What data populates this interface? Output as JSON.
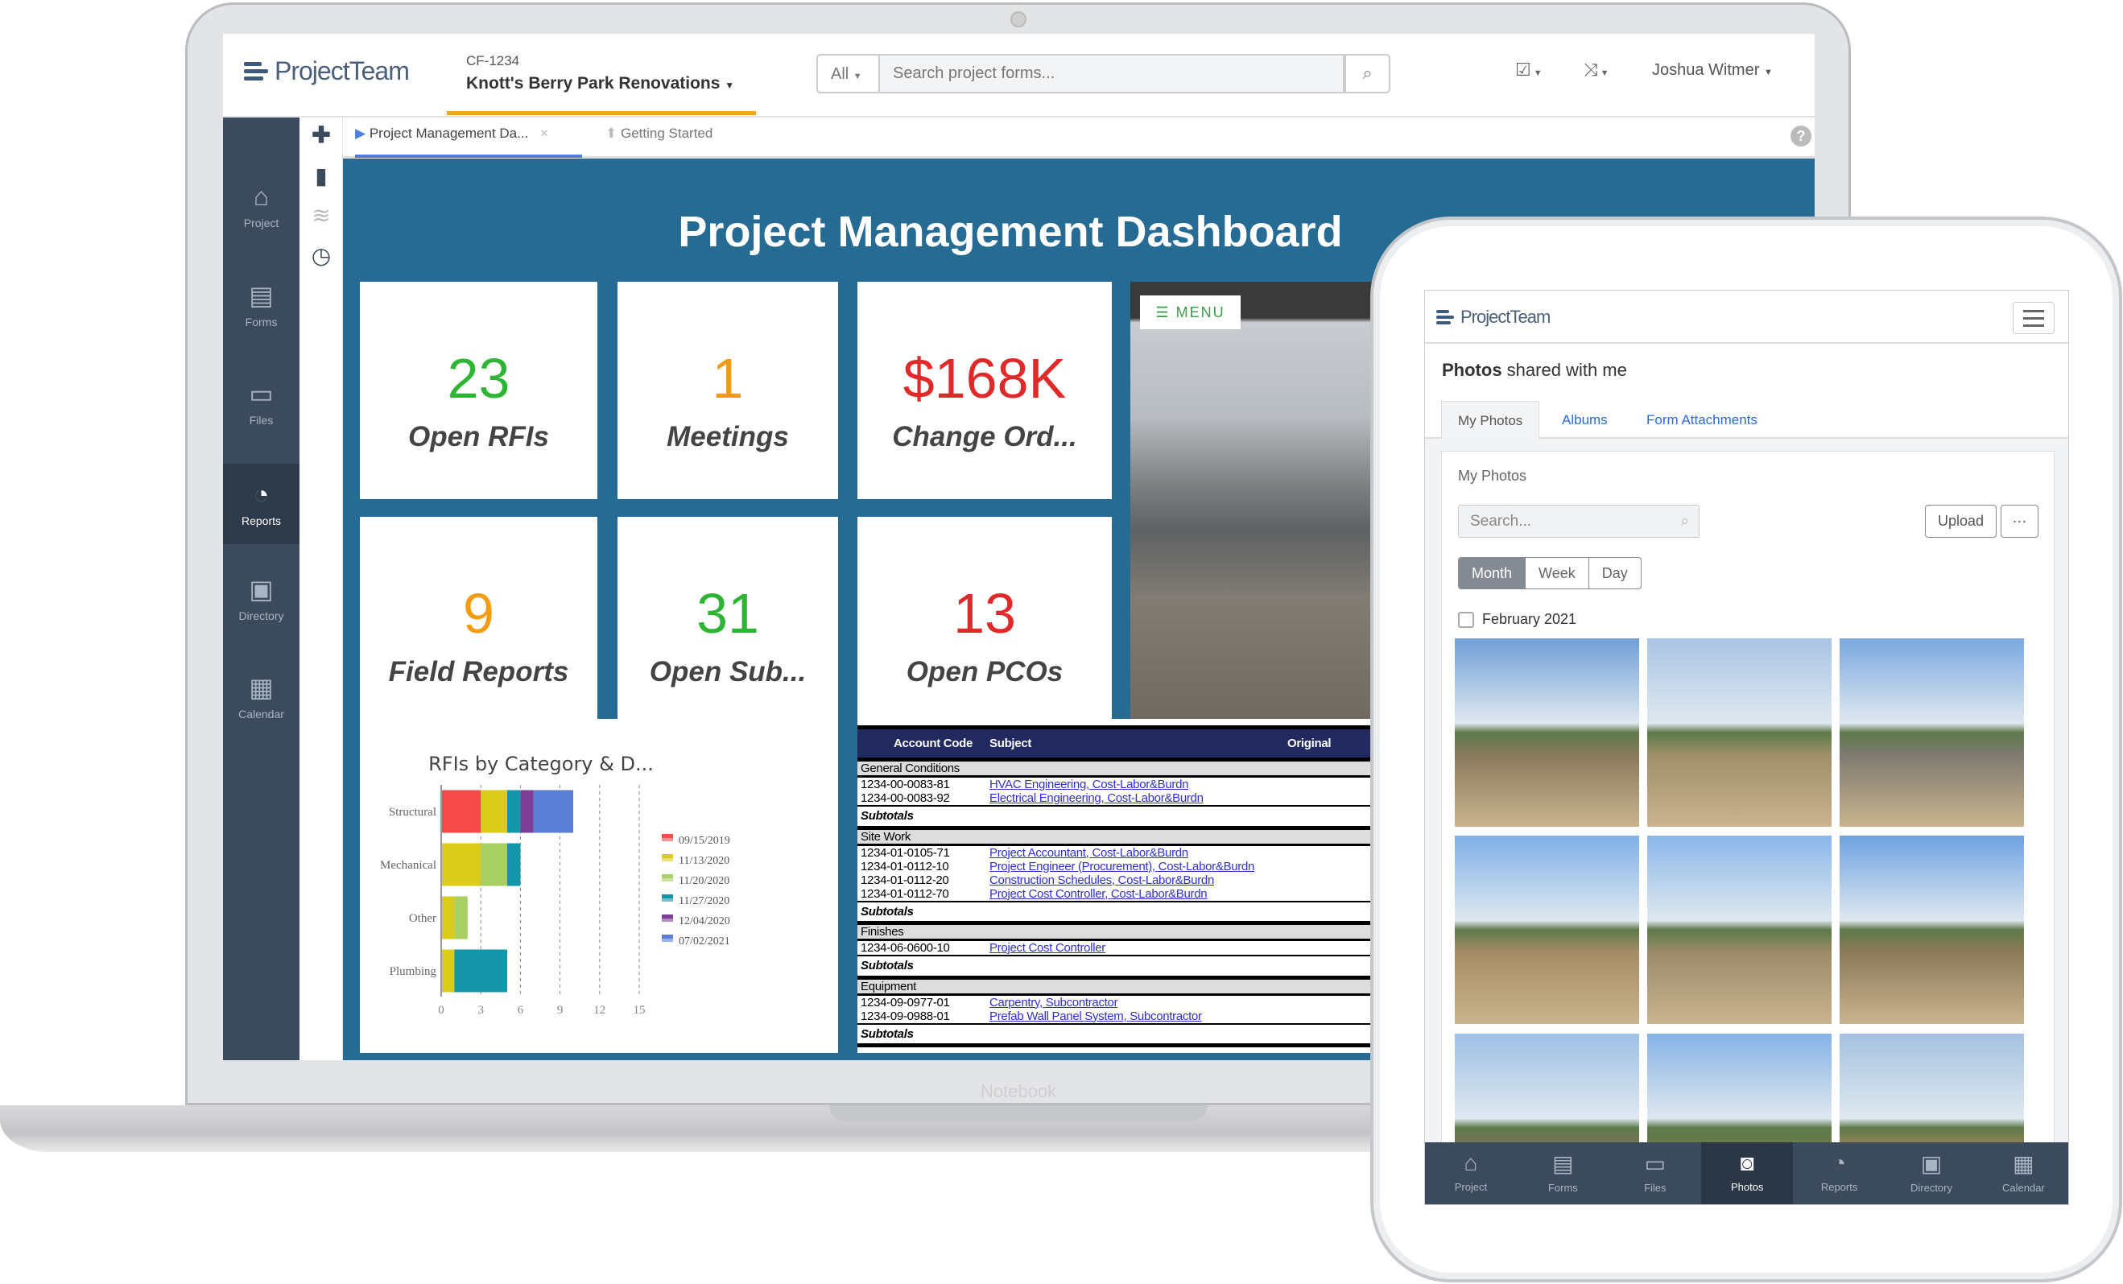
{
  "laptop": {
    "brand_label": "Notebook",
    "header": {
      "logo": "ProjectTeam",
      "project_code": "CF-1234",
      "project_name": "Knott's Berry Park Renovations",
      "search_scope": "All",
      "search_placeholder": "Search project forms...",
      "user_name": "Joshua Witmer"
    },
    "sidebar": [
      {
        "label": "Project",
        "icon": "home-icon",
        "glyph": "⌂"
      },
      {
        "label": "Forms",
        "icon": "document-icon",
        "glyph": "▤"
      },
      {
        "label": "Files",
        "icon": "folder-icon",
        "glyph": "▭"
      },
      {
        "label": "Reports",
        "icon": "dashboard-icon",
        "glyph": "◔",
        "active": true
      },
      {
        "label": "Directory",
        "icon": "contact-book-icon",
        "glyph": "▣"
      },
      {
        "label": "Calendar",
        "icon": "calendar-icon",
        "glyph": "▦"
      }
    ],
    "tabs": [
      {
        "label": "Project Management Da...",
        "active": true
      },
      {
        "label": "Getting Started"
      }
    ],
    "dashboard": {
      "title": "Project Management Dashboard",
      "tiles": [
        {
          "value": "23",
          "label": "Open RFIs",
          "color": "#2db533"
        },
        {
          "value": "1",
          "label": "Meetings",
          "color": "#f39c12"
        },
        {
          "value": "$168K",
          "label": "Change Ord...",
          "color": "#e02a2a"
        },
        {
          "value": "9",
          "label": "Field Reports",
          "color": "#f39c12"
        },
        {
          "value": "31",
          "label": "Open Sub...",
          "color": "#2db533"
        },
        {
          "value": "13",
          "label": "Open PCOs",
          "color": "#e02a2a"
        }
      ],
      "photo_menu_label": "MENU"
    },
    "table": {
      "columns": [
        "Account Code",
        "Subject",
        "Original"
      ],
      "groups": [
        {
          "name": "General Conditions",
          "rows": [
            [
              "1234-00-0083-81",
              "HVAC Engineering, Cost-Labor&Burdn"
            ],
            [
              "1234-00-0083-92",
              "Electrical Engineering, Cost-Labor&Burdn"
            ]
          ]
        },
        {
          "name": "Site Work",
          "rows": [
            [
              "1234-01-0105-71",
              "Project Accountant, Cost-Labor&Burdn"
            ],
            [
              "1234-01-0112-10",
              "Project Engineer (Procurement), Cost-Labor&Burdn"
            ],
            [
              "1234-01-0112-20",
              "Construction Schedules, Cost-Labor&Burdn"
            ],
            [
              "1234-01-0112-70",
              "Project Cost Controller, Cost-Labor&Burdn"
            ]
          ]
        },
        {
          "name": "Finishes",
          "rows": [
            [
              "1234-06-0600-10",
              "Project Cost Controller"
            ]
          ]
        },
        {
          "name": "Equipment",
          "rows": [
            [
              "1234-09-0977-01",
              "Carpentry, Subcontractor"
            ],
            [
              "1234-09-0988-01",
              "Prefab Wall Panel System, Subcontractor"
            ]
          ]
        }
      ],
      "subtotal_label": "Subtotals"
    }
  },
  "chart_data": {
    "type": "bar",
    "orientation": "horizontal",
    "stacked": true,
    "title": "RFIs by Category & D...",
    "categories": [
      "Structural",
      "Mechanical",
      "Other",
      "Plumbing"
    ],
    "series": [
      {
        "name": "09/15/2019",
        "color": "#f64b4b",
        "values": [
          3,
          0,
          0,
          0
        ]
      },
      {
        "name": "11/13/2020",
        "color": "#dbcc1c",
        "values": [
          2,
          3,
          1,
          1
        ]
      },
      {
        "name": "11/20/2020",
        "color": "#a8d062",
        "values": [
          0,
          2,
          1,
          0
        ]
      },
      {
        "name": "11/27/2020",
        "color": "#1496a8",
        "values": [
          1,
          1,
          0,
          4
        ]
      },
      {
        "name": "12/04/2020",
        "color": "#7b3f98",
        "values": [
          1,
          0,
          0,
          0
        ]
      },
      {
        "name": "07/02/2021",
        "color": "#5b7fd6",
        "values": [
          3,
          0,
          0,
          0
        ]
      }
    ],
    "xlim": [
      0,
      15
    ],
    "xticks": [
      0,
      3,
      6,
      9,
      12,
      15
    ],
    "grid": "vertical dashed",
    "legend": "right"
  },
  "tablet": {
    "logo": "ProjectTeam",
    "title_bold": "Photos",
    "title_rest": " shared with me",
    "tabs": [
      {
        "label": "My Photos",
        "active": true
      },
      {
        "label": "Albums"
      },
      {
        "label": "Form Attachments"
      }
    ],
    "card_title": "My Photos",
    "search_placeholder": "Search...",
    "upload_label": "Upload",
    "more_label": "···",
    "views": [
      {
        "label": "Month",
        "active": true
      },
      {
        "label": "Week"
      },
      {
        "label": "Day"
      }
    ],
    "group_label": "February 2021",
    "nav": [
      {
        "label": "Project",
        "icon": "home-icon",
        "glyph": "⌂"
      },
      {
        "label": "Forms",
        "icon": "document-icon",
        "glyph": "▤"
      },
      {
        "label": "Files",
        "icon": "folder-icon",
        "glyph": "▭"
      },
      {
        "label": "Photos",
        "icon": "camera-icon",
        "glyph": "◙",
        "active": true
      },
      {
        "label": "Reports",
        "icon": "dashboard-icon",
        "glyph": "◔"
      },
      {
        "label": "Directory",
        "icon": "contact-book-icon",
        "glyph": "▣"
      },
      {
        "label": "Calendar",
        "icon": "calendar-icon",
        "glyph": "▦"
      }
    ]
  }
}
